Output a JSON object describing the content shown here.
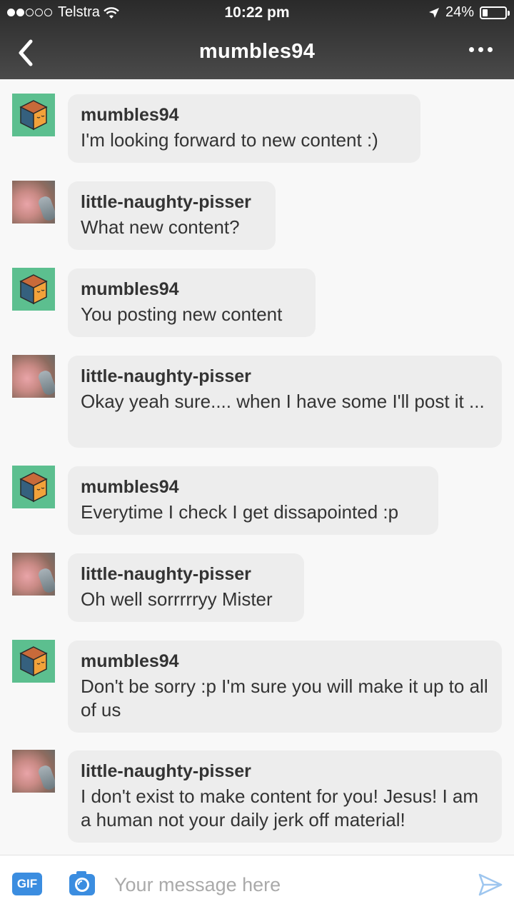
{
  "status_bar": {
    "carrier": "Telstra",
    "time": "10:22 pm",
    "battery": "24%",
    "battery_level": 0.24,
    "signal_bars": 2
  },
  "header": {
    "title": "mumbles94",
    "back_icon": "chevron-left-icon",
    "more_icon": "more-horizontal-icon"
  },
  "messages": [
    {
      "sender": "mumbles94",
      "text": "I'm looking forward to new content :)",
      "avatar": "cube-avatar"
    },
    {
      "sender": "little-naughty-pisser",
      "text": "What new content?",
      "avatar": "photo-avatar"
    },
    {
      "sender": "mumbles94",
      "text": "You posting new content",
      "avatar": "cube-avatar"
    },
    {
      "sender": "little-naughty-pisser",
      "text": "Okay yeah sure.... when I have some I'll post it ...",
      "avatar": "photo-avatar"
    },
    {
      "sender": "mumbles94",
      "text": "Everytime I check I get dissapointed :p",
      "avatar": "cube-avatar"
    },
    {
      "sender": "little-naughty-pisser",
      "text": "Oh well sorrrrryy Mister",
      "avatar": "photo-avatar"
    },
    {
      "sender": "mumbles94",
      "text": "Don't be sorry :p I'm sure you will make it up to all of us",
      "avatar": "cube-avatar"
    },
    {
      "sender": "little-naughty-pisser",
      "text": "I don't exist to make content for you! Jesus! I am a human not your daily jerk off material!",
      "avatar": "photo-avatar"
    }
  ],
  "composer": {
    "gif_label": "GIF",
    "placeholder": "Your message here",
    "camera_icon": "camera-icon",
    "send_icon": "send-icon"
  },
  "colors": {
    "header_bg": "#3a3a3a",
    "bubble_bg": "#ededed",
    "cube_avatar_bg": "#5cbf8f",
    "accent": "#3b8de0"
  }
}
